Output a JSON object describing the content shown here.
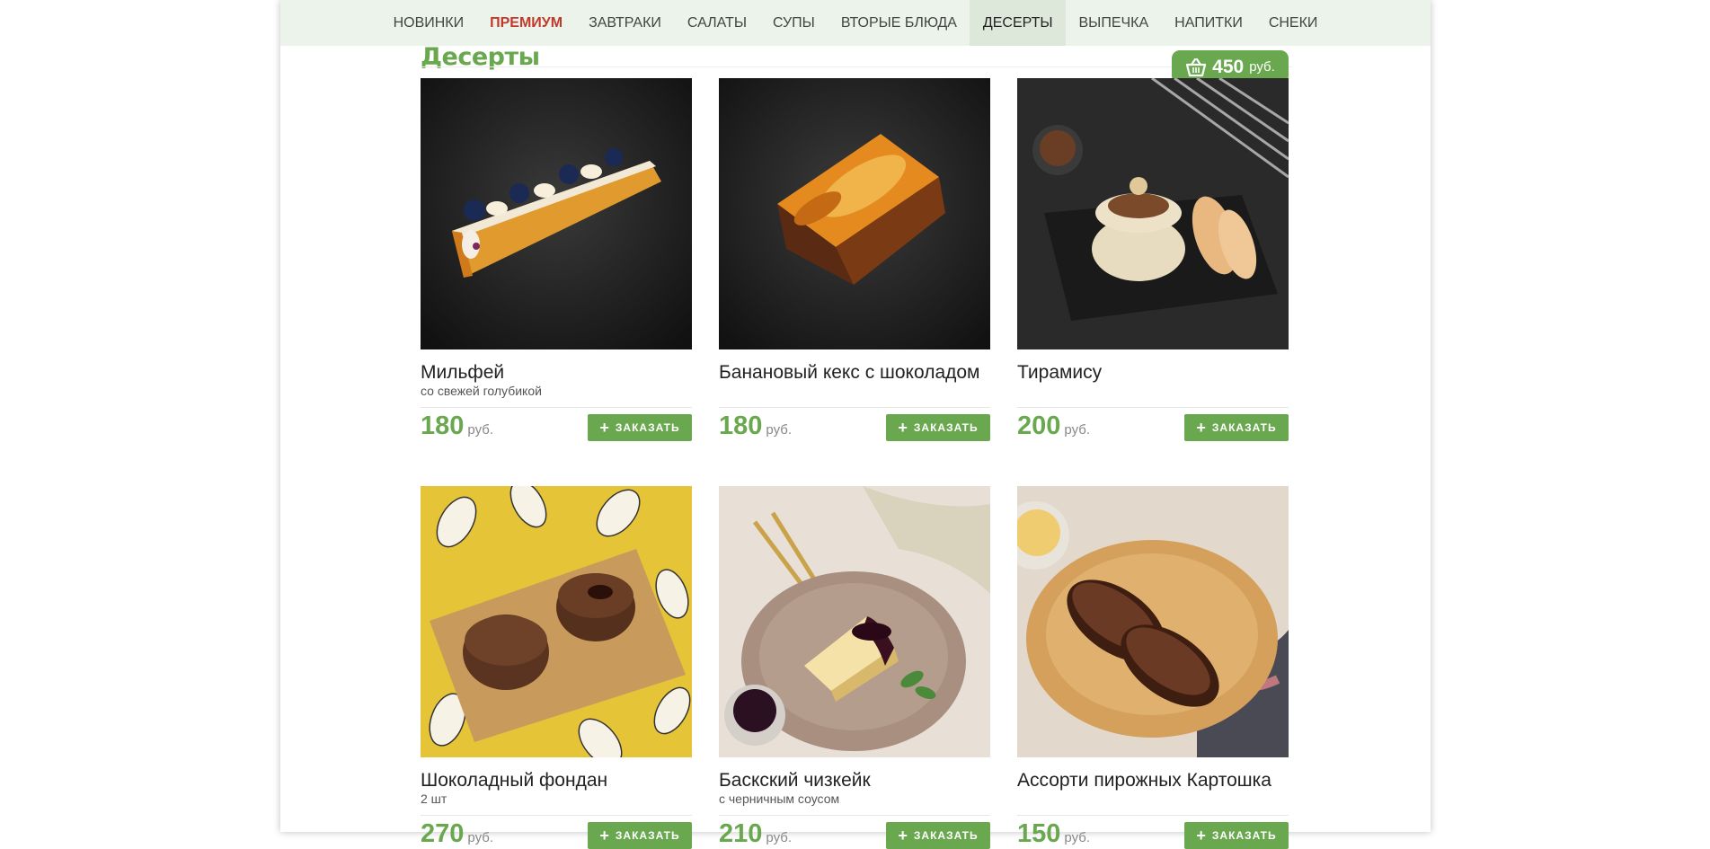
{
  "nav": {
    "items": [
      {
        "label": "НОВИНКИ"
      },
      {
        "label": "ПРЕМИУМ"
      },
      {
        "label": "ЗАВТРАКИ"
      },
      {
        "label": "САЛАТЫ"
      },
      {
        "label": "СУПЫ"
      },
      {
        "label": "ВТОРЫЕ БЛЮДА"
      },
      {
        "label": "ДЕСЕРТЫ"
      },
      {
        "label": "ВЫПЕЧКА"
      },
      {
        "label": "НАПИТКИ"
      },
      {
        "label": "СНЕКИ"
      }
    ],
    "active": "ДЕСЕРТЫ",
    "highlight": "ПРЕМИУМ"
  },
  "section": {
    "title": "Десерты"
  },
  "cart": {
    "amount": "450",
    "currency": "руб.",
    "icon": "basket-icon"
  },
  "order_label": "ЗАКАЗАТЬ",
  "currency": "руб.",
  "products": [
    {
      "name": "Мильфей",
      "desc": "со свежей голубикой",
      "price": "180"
    },
    {
      "name": "Банановый кекс с шоколадом",
      "desc": "",
      "price": "180"
    },
    {
      "name": "Тирамису",
      "desc": "",
      "price": "200"
    },
    {
      "name": "Шоколадный фондан",
      "desc": "2 шт",
      "price": "270"
    },
    {
      "name": "Баскский чизкейк",
      "desc": "с черничным соусом",
      "price": "210"
    },
    {
      "name": "Ассорти пирожных Картошка",
      "desc": "",
      "price": "150"
    }
  ],
  "colors": {
    "accent": "#6aa84f",
    "premium": "#c0392b",
    "nav_bg": "#ecf3ea"
  }
}
